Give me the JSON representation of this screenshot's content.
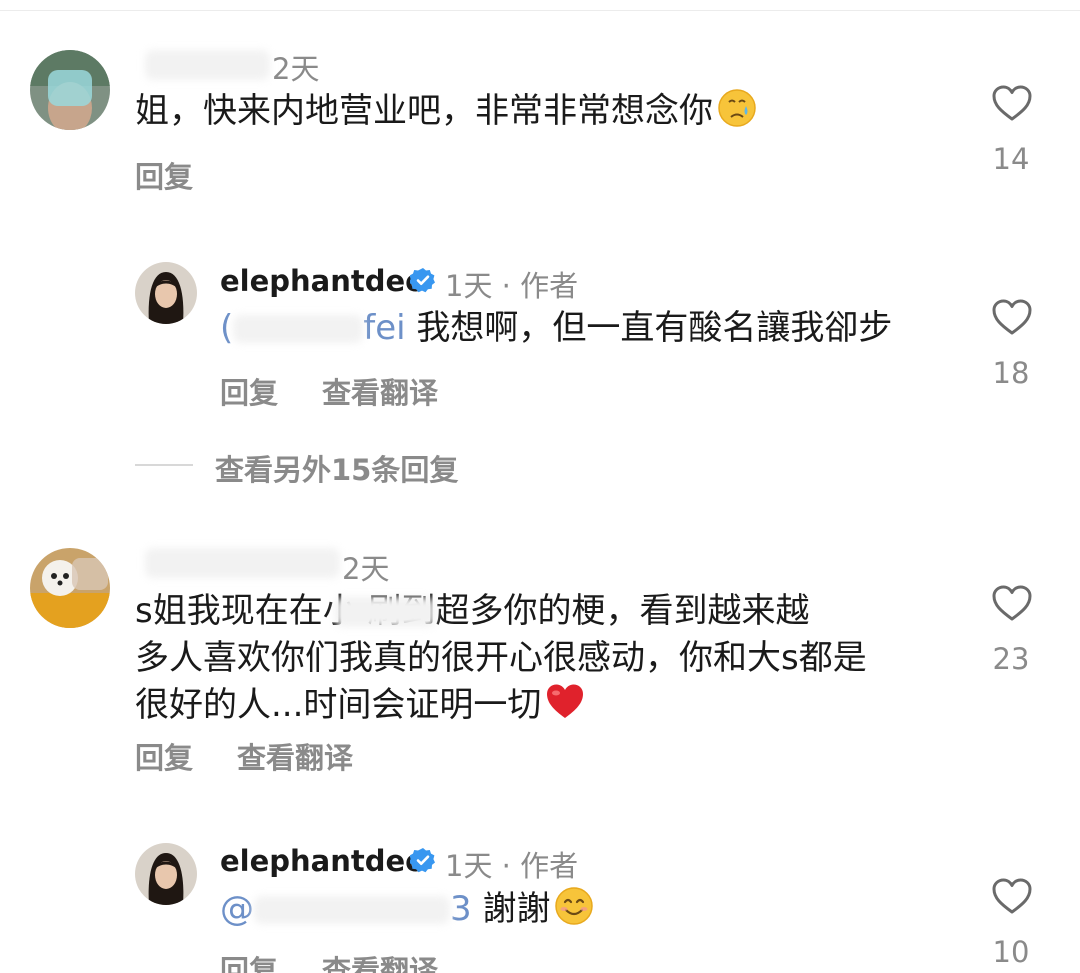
{
  "comments": [
    {
      "time": "2天",
      "text": "姐，快来内地营业吧，非常非常想念你",
      "emoji": "crying-face",
      "reply_label": "回复",
      "likes": "14"
    },
    {
      "username": "elephantdee",
      "meta": "1天 · 作者",
      "mention": "fei",
      "text": " 我想啊，但一直有酸名讓我卻步",
      "reply_label": "回复",
      "translate_label": "查看翻译",
      "likes": "18"
    },
    {
      "time": "2天",
      "text_lines": [
        "s姐我现在在小    刷到超多你的梗，看到越来越",
        "多人喜欢你们我真的很开心很感动，你和大s都是",
        "很好的人...时间会证明一切"
      ],
      "emoji": "red-heart",
      "reply_label": "回复",
      "translate_label": "查看翻译",
      "likes": "23"
    },
    {
      "username": "elephantdee",
      "meta": "1天 · 作者",
      "mention": "3",
      "text": " 謝謝",
      "emoji": "smiling-face",
      "reply_label": "回复",
      "translate_label": "查看翻译",
      "likes": "10"
    }
  ],
  "view_more_replies": "查看另外15条回复",
  "colors": {
    "text": "#1a1a1a",
    "muted": "#8a8a8a",
    "mention": "#6d90c8",
    "verified": "#3897f0",
    "heart_emoji": "#e0222c"
  }
}
